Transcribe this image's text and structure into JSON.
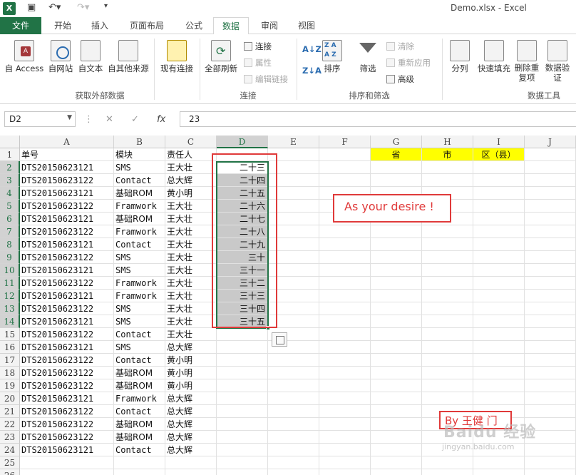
{
  "title": "Demo.xlsx - Excel",
  "app_icon": "X",
  "qat": {
    "save": "save-icon",
    "undo": "undo-icon",
    "redo": "redo-icon",
    "more": "customize-icon"
  },
  "tabs": [
    "文件",
    "开始",
    "插入",
    "页面布局",
    "公式",
    "数据",
    "审阅",
    "视图"
  ],
  "active_tab": "数据",
  "ribbon": {
    "get_external": {
      "label": "获取外部数据",
      "buttons": [
        "自 Access",
        "自网站",
        "自文本",
        "自其他来源"
      ]
    },
    "existing_conn": "现有连接",
    "connections": {
      "label": "连接",
      "refresh_all": "全部刷新",
      "items": [
        "连接",
        "属性",
        "编辑链接"
      ]
    },
    "sort_filter": {
      "label": "排序和筛选",
      "sort": "排序",
      "filter": "筛选",
      "items": [
        "清除",
        "重新应用",
        "高级"
      ]
    },
    "data_tools": {
      "label": "数据工具",
      "buttons": [
        "分列",
        "快速填充",
        "删除重复项",
        "数据验证"
      ]
    }
  },
  "namebox": "D2",
  "formula": "23",
  "columns": [
    "A",
    "B",
    "C",
    "D",
    "E",
    "F",
    "G",
    "H",
    "I",
    "J"
  ],
  "selected_column": "D",
  "header_row": {
    "a": "单号",
    "b": "模块",
    "c": "责任人",
    "g": "省",
    "h": "市",
    "i": "区（县）"
  },
  "rows": [
    {
      "a": "DTS20150623121",
      "b": "SMS",
      "c": "王大壮",
      "d": "二十三"
    },
    {
      "a": "DTS20150623122",
      "b": "Contact",
      "c": "总大辉",
      "d": "二十四"
    },
    {
      "a": "DTS20150623121",
      "b": "基础ROM",
      "c": "黄小明",
      "d": "二十五"
    },
    {
      "a": "DTS20150623122",
      "b": "Framwork",
      "c": "王大壮",
      "d": "二十六"
    },
    {
      "a": "DTS20150623121",
      "b": "基础ROM",
      "c": "王大壮",
      "d": "二十七"
    },
    {
      "a": "DTS20150623122",
      "b": "Framwork",
      "c": "王大壮",
      "d": "二十八"
    },
    {
      "a": "DTS20150623121",
      "b": "Contact",
      "c": "王大壮",
      "d": "二十九"
    },
    {
      "a": "DTS20150623122",
      "b": "SMS",
      "c": "王大壮",
      "d": "三十"
    },
    {
      "a": "DTS20150623121",
      "b": "SMS",
      "c": "王大壮",
      "d": "三十一"
    },
    {
      "a": "DTS20150623122",
      "b": "Framwork",
      "c": "王大壮",
      "d": "三十二"
    },
    {
      "a": "DTS20150623121",
      "b": "Framwork",
      "c": "王大壮",
      "d": "三十三"
    },
    {
      "a": "DTS20150623122",
      "b": "SMS",
      "c": "王大壮",
      "d": "三十四"
    },
    {
      "a": "DTS20150623121",
      "b": "SMS",
      "c": "王大壮",
      "d": "三十五"
    },
    {
      "a": "DTS20150623122",
      "b": "Contact",
      "c": "王大壮",
      "d": ""
    },
    {
      "a": "DTS20150623121",
      "b": "SMS",
      "c": "总大辉",
      "d": ""
    },
    {
      "a": "DTS20150623122",
      "b": "Contact",
      "c": "黄小明",
      "d": ""
    },
    {
      "a": "DTS20150623122",
      "b": "基础ROM",
      "c": "黄小明",
      "d": ""
    },
    {
      "a": "DTS20150623122",
      "b": "基础ROM",
      "c": "黄小明",
      "d": ""
    },
    {
      "a": "DTS20150623121",
      "b": "Framwork",
      "c": "总大辉",
      "d": ""
    },
    {
      "a": "DTS20150623122",
      "b": "Contact",
      "c": "总大辉",
      "d": ""
    },
    {
      "a": "DTS20150623122",
      "b": "基础ROM",
      "c": "总大辉",
      "d": ""
    },
    {
      "a": "DTS20150623122",
      "b": "基础ROM",
      "c": "总大辉",
      "d": ""
    },
    {
      "a": "DTS20150623121",
      "b": "Contact",
      "c": "总大辉",
      "d": ""
    }
  ],
  "empty_rows": [
    "25",
    "26"
  ],
  "annotation_note": "As your desire !",
  "byline": "By 王健 门",
  "watermark": "Baidu 经验",
  "watermark_url": "jingyan.baidu.com",
  "colors": {
    "excel_green": "#217346",
    "highlight_yellow": "#ffff00",
    "annotation_red": "#e03a3a",
    "selection_gray": "#c9c9c9"
  }
}
